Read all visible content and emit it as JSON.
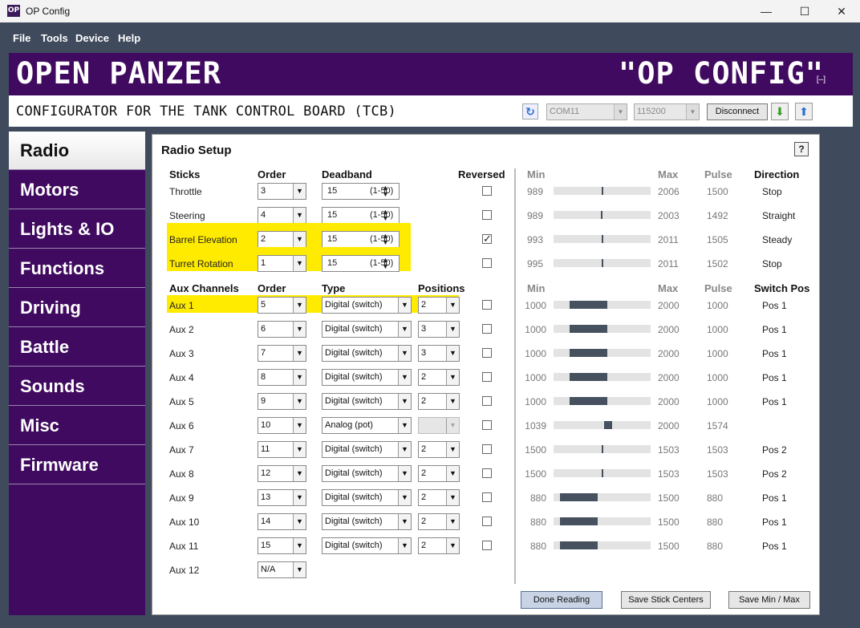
{
  "window": {
    "app_icon": "OP",
    "title": "OP Config",
    "minimize": "—",
    "maximize": "☐",
    "close": "✕"
  },
  "menu": [
    "File",
    "Tools",
    "Device",
    "Help"
  ],
  "banner": {
    "left": "OPEN PANZER",
    "right": "\"OP CONFIG\"",
    "min_glyph": "[–]"
  },
  "subheader": {
    "title": "CONFIGURATOR FOR THE TANK CONTROL BOARD (TCB)",
    "port": "COM11",
    "baud": "115200",
    "disconnect_label": "Disconnect"
  },
  "nav": [
    {
      "label": "Radio",
      "active": true
    },
    {
      "label": "Motors"
    },
    {
      "label": "Lights & IO"
    },
    {
      "label": "Functions"
    },
    {
      "label": "Driving"
    },
    {
      "label": "Battle"
    },
    {
      "label": "Sounds"
    },
    {
      "label": "Misc"
    },
    {
      "label": "Firmware"
    }
  ],
  "radio": {
    "title": "Radio Setup",
    "help": "?",
    "sticks_headers": {
      "sticks": "Sticks",
      "order": "Order",
      "deadband": "Deadband",
      "reversed": "Reversed",
      "min": "Min",
      "max": "Max",
      "pulse": "Pulse",
      "direction": "Direction"
    },
    "sticks": [
      {
        "name": "Throttle",
        "order": "3",
        "deadband": "15",
        "range": "(1-50)",
        "reversed": false,
        "min": "989",
        "max": "2006",
        "pulse": "1500",
        "direction": "Stop",
        "pos": 0.5,
        "highlight": false
      },
      {
        "name": "Steering",
        "order": "4",
        "deadband": "15",
        "range": "(1-50)",
        "reversed": false,
        "min": "989",
        "max": "2003",
        "pulse": "1492",
        "direction": "Straight",
        "pos": 0.495,
        "highlight": false
      },
      {
        "name": "Barrel Elevation",
        "order": "2",
        "deadband": "15",
        "range": "(1-50)",
        "reversed": true,
        "min": "993",
        "max": "2011",
        "pulse": "1505",
        "direction": "Steady",
        "pos": 0.502,
        "highlight": true
      },
      {
        "name": "Turret Rotation",
        "order": "1",
        "deadband": "15",
        "range": "(1-50)",
        "reversed": false,
        "min": "995",
        "max": "2011",
        "pulse": "1502",
        "direction": "Stop",
        "pos": 0.5,
        "highlight": true
      }
    ],
    "aux_headers": {
      "aux": "Aux Channels",
      "order": "Order",
      "type": "Type",
      "positions": "Positions",
      "min": "Min",
      "max": "Max",
      "pulse": "Pulse",
      "switch_pos": "Switch Pos"
    },
    "aux": [
      {
        "name": "Aux 1",
        "order": "5",
        "type": "Digital (switch)",
        "positions": "2",
        "min": "1000",
        "max": "2000",
        "pulse": "1000",
        "switch_pos": "Pos 1",
        "highlight": true
      },
      {
        "name": "Aux 2",
        "order": "6",
        "type": "Digital (switch)",
        "positions": "3",
        "min": "1000",
        "max": "2000",
        "pulse": "1000",
        "switch_pos": "Pos 1"
      },
      {
        "name": "Aux 3",
        "order": "7",
        "type": "Digital (switch)",
        "positions": "3",
        "min": "1000",
        "max": "2000",
        "pulse": "1000",
        "switch_pos": "Pos 1"
      },
      {
        "name": "Aux 4",
        "order": "8",
        "type": "Digital (switch)",
        "positions": "2",
        "min": "1000",
        "max": "2000",
        "pulse": "1000",
        "switch_pos": "Pos 1"
      },
      {
        "name": "Aux 5",
        "order": "9",
        "type": "Digital (switch)",
        "positions": "2",
        "min": "1000",
        "max": "2000",
        "pulse": "1000",
        "switch_pos": "Pos 1"
      },
      {
        "name": "Aux 6",
        "order": "10",
        "type": "Analog (pot)",
        "positions": "",
        "min": "1039",
        "max": "2000",
        "pulse": "1574",
        "switch_pos": "",
        "analog": true
      },
      {
        "name": "Aux 7",
        "order": "11",
        "type": "Digital (switch)",
        "positions": "2",
        "min": "1500",
        "max": "1503",
        "pulse": "1503",
        "switch_pos": "Pos 2"
      },
      {
        "name": "Aux 8",
        "order": "12",
        "type": "Digital (switch)",
        "positions": "2",
        "min": "1500",
        "max": "1503",
        "pulse": "1503",
        "switch_pos": "Pos 2"
      },
      {
        "name": "Aux 9",
        "order": "13",
        "type": "Digital (switch)",
        "positions": "2",
        "min": "880",
        "max": "1500",
        "pulse": "880",
        "switch_pos": "Pos 1"
      },
      {
        "name": "Aux 10",
        "order": "14",
        "type": "Digital (switch)",
        "positions": "2",
        "min": "880",
        "max": "1500",
        "pulse": "880",
        "switch_pos": "Pos 1"
      },
      {
        "name": "Aux 11",
        "order": "15",
        "type": "Digital (switch)",
        "positions": "2",
        "min": "880",
        "max": "1500",
        "pulse": "880",
        "switch_pos": "Pos 1"
      },
      {
        "name": "Aux 12",
        "order": "N/A",
        "type": null
      }
    ],
    "buttons": {
      "done_reading": "Done Reading",
      "save_centers": "Save Stick Centers",
      "save_minmax": "Save Min / Max"
    }
  },
  "colors": {
    "purple": "#3f0a5f",
    "highlight": "#ffeb00",
    "bar_fill": "#46505f",
    "bar_track": "#e3e3e3"
  }
}
